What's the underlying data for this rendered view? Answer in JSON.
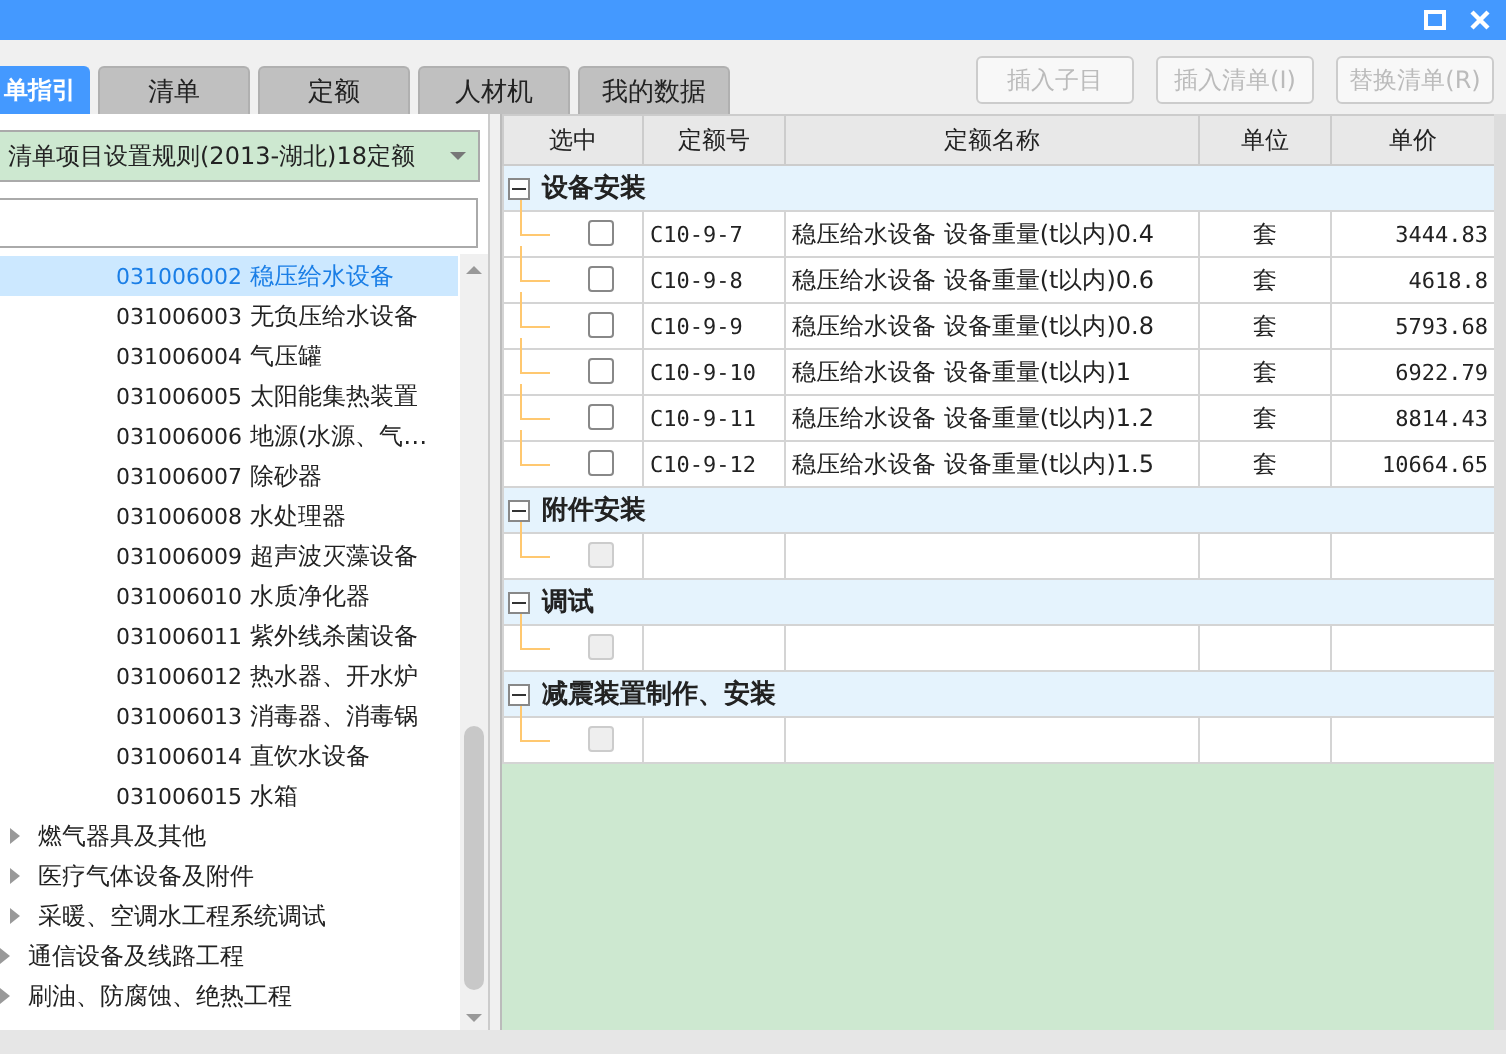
{
  "tabs": [
    {
      "label": "单指引",
      "selected": true
    },
    {
      "label": "清单",
      "selected": false
    },
    {
      "label": "定额",
      "selected": false
    },
    {
      "label": "人材机",
      "selected": false
    },
    {
      "label": "我的数据",
      "selected": false
    }
  ],
  "buttons": [
    {
      "label": "插入子目",
      "disabled": true
    },
    {
      "label": "插入清单(I)",
      "disabled": true
    },
    {
      "label": "替换清单(R)",
      "disabled": true
    }
  ],
  "library_select": {
    "value": "清单项目设置规则(2013-湖北)18定额"
  },
  "tree": {
    "items": [
      {
        "children": [
          {
            "children": [
              {
                "code": "031006002",
                "label": "稳压给水设备",
                "selected": true
              },
              {
                "code": "031006003",
                "label": "无负压给水设备",
                "selected": false
              },
              {
                "code": "031006004",
                "label": "气压罐",
                "selected": false
              },
              {
                "code": "031006005",
                "label": "太阳能集热装置",
                "selected": false
              },
              {
                "code": "031006006",
                "label": "地源(水源、气…",
                "selected": false
              },
              {
                "code": "031006007",
                "label": "除砂器",
                "selected": false
              },
              {
                "code": "031006008",
                "label": "水处理器",
                "selected": false
              },
              {
                "code": "031006009",
                "label": "超声波灭藻设备",
                "selected": false
              },
              {
                "code": "031006010",
                "label": "水质净化器",
                "selected": false
              },
              {
                "code": "031006011",
                "label": "紫外线杀菌设备",
                "selected": false
              },
              {
                "code": "031006012",
                "label": "热水器、开水炉",
                "selected": false
              },
              {
                "code": "031006013",
                "label": "消毒器、消毒锅",
                "selected": false
              },
              {
                "code": "031006014",
                "label": "直饮水设备",
                "selected": false
              },
              {
                "code": "031006015",
                "label": "水箱",
                "selected": false
              }
            ]
          },
          {
            "label": "燃气器具及其他",
            "expanded": false
          },
          {
            "label": "医疗气体设备及附件",
            "expanded": false
          },
          {
            "label": "采暖、空调水工程系统调试",
            "expanded": false
          }
        ]
      },
      {
        "label": "通信设备及线路工程",
        "expanded": false
      },
      {
        "label": "刷油、防腐蚀、绝热工程",
        "expanded": false
      }
    ]
  },
  "table": {
    "columns": [
      "选中",
      "定额号",
      "定额名称",
      "单位",
      "单价"
    ],
    "groups": [
      {
        "title": "设备安装",
        "expanded": true,
        "rows": [
          {
            "checked": false,
            "disabled": false,
            "code": "C10-9-7",
            "name": "稳压给水设备 设备重量(t以内)0.4",
            "unit": "套",
            "price": "3444.83"
          },
          {
            "checked": false,
            "disabled": false,
            "code": "C10-9-8",
            "name": "稳压给水设备 设备重量(t以内)0.6",
            "unit": "套",
            "price": "4618.8"
          },
          {
            "checked": false,
            "disabled": false,
            "code": "C10-9-9",
            "name": "稳压给水设备 设备重量(t以内)0.8",
            "unit": "套",
            "price": "5793.68"
          },
          {
            "checked": false,
            "disabled": false,
            "code": "C10-9-10",
            "name": "稳压给水设备 设备重量(t以内)1",
            "unit": "套",
            "price": "6922.79"
          },
          {
            "checked": false,
            "disabled": false,
            "code": "C10-9-11",
            "name": "稳压给水设备 设备重量(t以内)1.2",
            "unit": "套",
            "price": "8814.43"
          },
          {
            "checked": false,
            "disabled": false,
            "code": "C10-9-12",
            "name": "稳压给水设备 设备重量(t以内)1.5",
            "unit": "套",
            "price": "10664.65"
          }
        ]
      },
      {
        "title": "附件安装",
        "expanded": true,
        "rows": [
          {
            "checked": false,
            "disabled": true
          }
        ]
      },
      {
        "title": "调试",
        "expanded": true,
        "rows": [
          {
            "checked": false,
            "disabled": true
          }
        ]
      },
      {
        "title": "减震装置制作、安装",
        "expanded": true,
        "rows": [
          {
            "checked": false,
            "disabled": true
          }
        ]
      }
    ]
  }
}
